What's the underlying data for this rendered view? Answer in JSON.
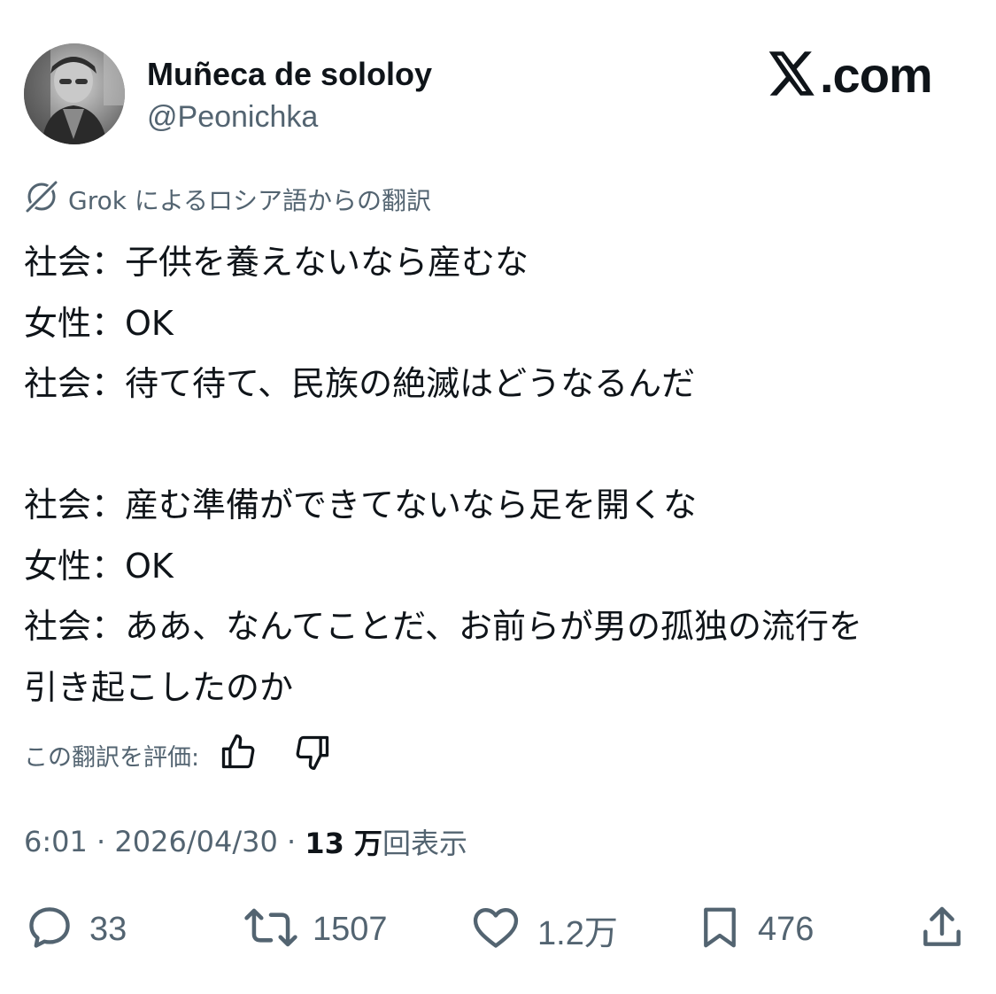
{
  "author": {
    "display_name": "Muñeca de sololoy",
    "handle": "@Peonichka",
    "avatar_icon": "profile-photo"
  },
  "site": {
    "logo_letter": "𝕏",
    "logo_domain": ".com"
  },
  "translation": {
    "note": "Grok によるロシア語からの翻訳",
    "icon": "grok-icon"
  },
  "tweet": {
    "lines": [
      "社会：子供を養えないなら産むな",
      "女性：OK",
      "社会：待て待て、民族の絶滅はどうなるんだ",
      "",
      "社会：産む準備ができてないなら足を開くな",
      "女性：OK",
      "社会：ああ、なんてことだ、お前らが男の孤独の流行を",
      "引き起こしたのか"
    ]
  },
  "rating": {
    "label": "この翻訳を評価:",
    "up_icon": "thumbs-up-icon",
    "down_icon": "thumbs-down-icon"
  },
  "meta": {
    "time": "6:01",
    "sep1": " · ",
    "date": "2026/04/30",
    "sep2": " · ",
    "views_count": "13 万",
    "views_label": "回表示"
  },
  "actions": {
    "replies": "33",
    "reposts": "1507",
    "likes": "1.2万",
    "bookmarks": "476",
    "share_icon": "share-icon"
  },
  "colors": {
    "text_primary": "#0f1419",
    "text_secondary": "#536471"
  }
}
